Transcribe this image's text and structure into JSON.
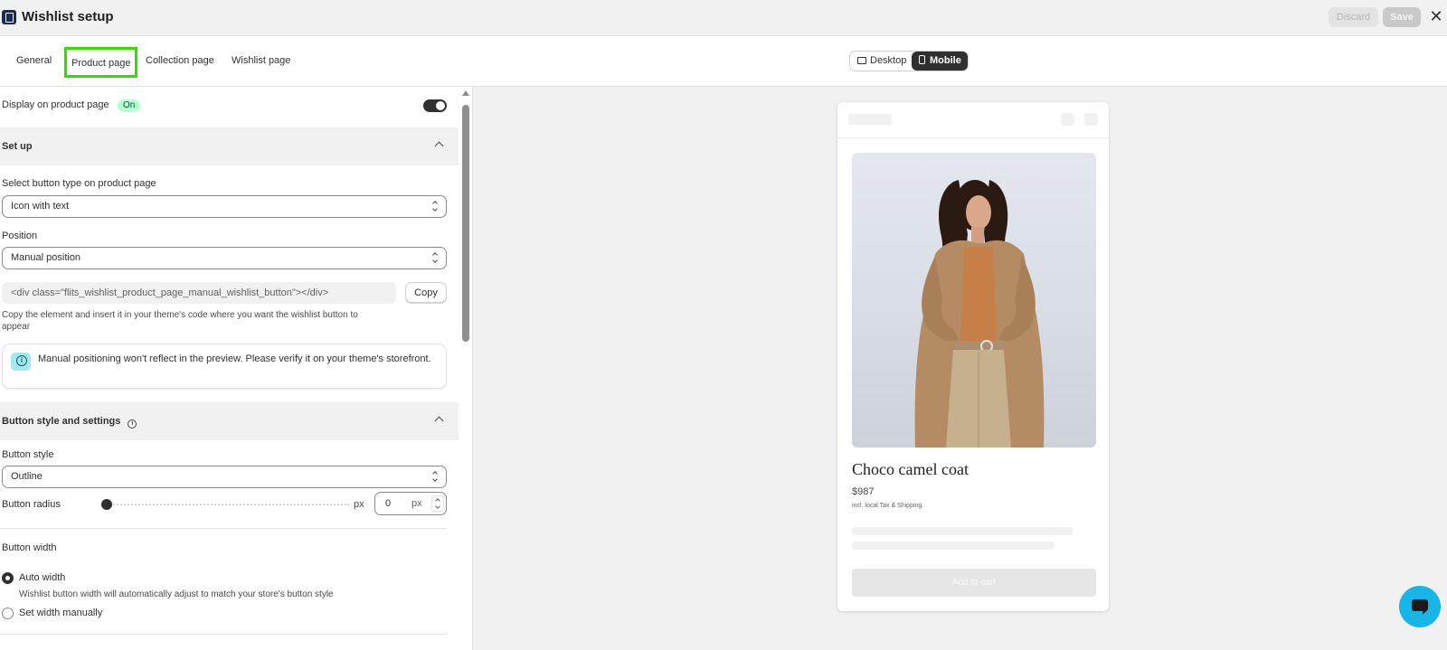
{
  "header": {
    "title": "Wishlist setup",
    "discard_label": "Discard",
    "save_label": "Save",
    "close_glyph": "✕"
  },
  "tabs": [
    {
      "label": "General"
    },
    {
      "label": "Product page",
      "active": true
    },
    {
      "label": "Collection page"
    },
    {
      "label": "Wishlist page"
    }
  ],
  "view_toggle": {
    "desktop_label": "Desktop",
    "mobile_label": "Mobile",
    "selected": "Mobile"
  },
  "settings": {
    "display_label": "Display on product page",
    "display_badge": "On",
    "display_enabled": true,
    "setup_section": {
      "title": "Set up",
      "button_type_label": "Select button type on product page",
      "button_type_value": "Icon with text",
      "position_label": "Position",
      "position_value": "Manual position",
      "code_snippet": "<div class=\"flits_wishlist_product_page_manual_wishlist_button\"></div>",
      "copy_label": "Copy",
      "help_text": "Copy the element and insert it in your theme's code where you want the wishlist button to appear",
      "banner_text": "Manual positioning won't reflect in the preview. Please verify it on your theme's storefront."
    },
    "style_section": {
      "title": "Button style and settings",
      "style_label": "Button style",
      "style_value": "Outline",
      "radius_label": "Button radius",
      "radius_unit": "px",
      "radius_value": "0",
      "width_label": "Button width",
      "auto_width_label": "Auto width",
      "auto_width_help": "Wishlist button width will automatically adjust to match your store's button style",
      "manual_width_label": "Set width manually",
      "selected_width": "Auto width"
    }
  },
  "preview": {
    "product_name": "Choco camel coat",
    "product_price": "$987",
    "tax_note": "incl. local Tax & Shipping.",
    "add_to_cart_label": "Add to cart"
  },
  "colors": {
    "accent_dark": "#303030",
    "active_tab_outline": "#33dd00",
    "badge_bg": "#b4fed2",
    "chat_bubble": "#18b5e7"
  }
}
